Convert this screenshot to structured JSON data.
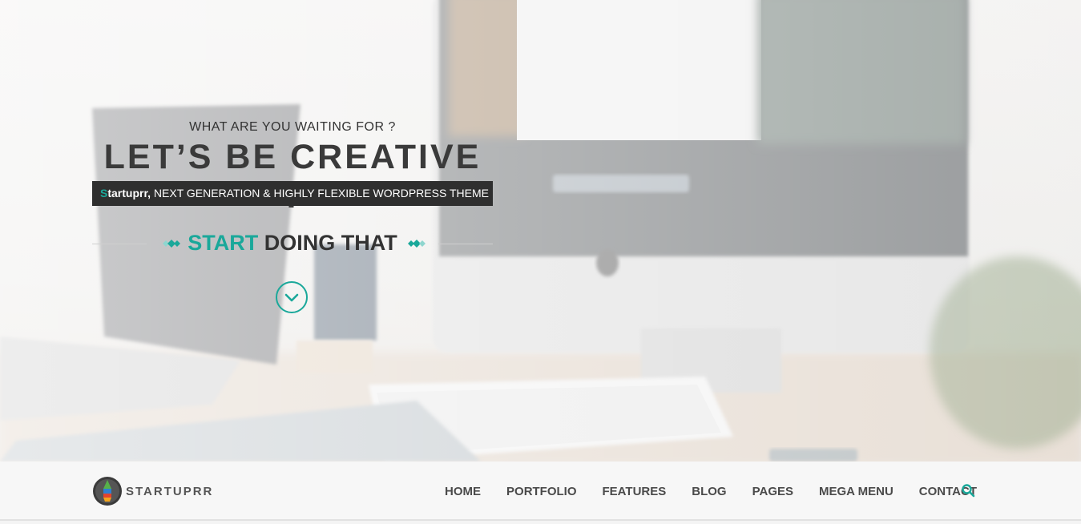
{
  "hero": {
    "kicker": "WHAT ARE YOU WAITING FOR ?",
    "headline": "LET’S BE CREATIVE !",
    "tagline_brand_first": "S",
    "tagline_brand_rest": "tartuprr,",
    "tagline_rest": " NEXT GENERATION & HIGHLY FLEXIBLE WORDPRESS THEME",
    "cta_accent": "START",
    "cta_rest": " DOING THAT",
    "scroll_icon": "chevron-down-icon"
  },
  "navbar": {
    "logo_text": "STARTUPRR",
    "items": [
      "HOME",
      "PORTFOLIO",
      "FEATURES",
      "BLOG",
      "PAGES",
      "MEGA MENU",
      "CONTACT"
    ],
    "search_icon": "search-icon"
  },
  "colors": {
    "accent": "#1aa89a",
    "headline": "#3a3a3a",
    "tagline_bg": "#2f2f2f",
    "navbar_bg": "#f7f7f7"
  }
}
